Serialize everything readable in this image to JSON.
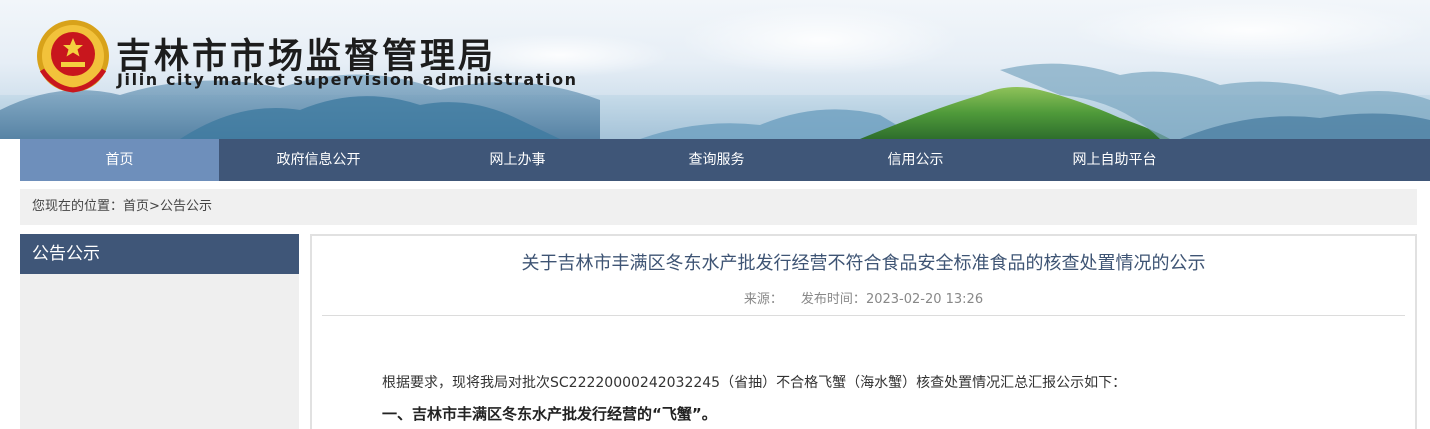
{
  "header": {
    "title": "吉林市市场监督管理局",
    "subtitle": "Jilin city market supervision administration",
    "emblem_text": "吉林市市场监督管理局"
  },
  "nav": {
    "items": [
      {
        "label": "首页",
        "active": true
      },
      {
        "label": "政府信息公开",
        "active": false
      },
      {
        "label": "网上办事",
        "active": false
      },
      {
        "label": "查询服务",
        "active": false
      },
      {
        "label": "信用公示",
        "active": false
      },
      {
        "label": "网上自助平台",
        "active": false
      }
    ]
  },
  "breadcrumb": {
    "prefix": "您现在的位置：",
    "home": "首页",
    "separator": ">",
    "current": "公告公示"
  },
  "sidebar": {
    "title": "公告公示"
  },
  "article": {
    "title": "关于吉林市丰满区冬东水产批发行经营不符合食品安全标准食品的核查处置情况的公示",
    "source_label": "来源：",
    "date_label": "发布时间：",
    "date": "2023-02-20 13:26",
    "paragraph": "根据要求，现将我局对批次SC22220000242032245（省抽）不合格飞蟹（海水蟹）核查处置情况汇总汇报公示如下：",
    "section1": "一、吉林市丰满区冬东水产批发行经营的“飞蟹”。"
  },
  "colors": {
    "nav_bg": "#3f5678",
    "nav_active": "#6e8fbb",
    "title_color": "#3e5474"
  }
}
